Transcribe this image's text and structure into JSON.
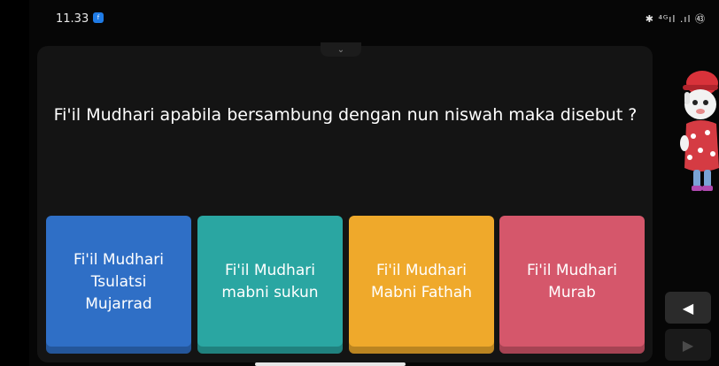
{
  "status_bar": {
    "time": "11.33",
    "app_badge": "f",
    "icons": "✱ ⁴ᴳıl .ıl ㊸"
  },
  "quiz": {
    "toggle_icon": "⌄",
    "question": "Fi'il Mudhari apabila bersambung dengan nun niswah maka disebut ?",
    "answers": [
      {
        "label": "Fi'il Mudhari Tsulatsi Mujarrad",
        "color": "#2f6fc6"
      },
      {
        "label": "Fi'il Mudhari mabni sukun",
        "color": "#2aa6a2"
      },
      {
        "label": "Fi'il Mudhari Mabni Fathah",
        "color": "#efa92b"
      },
      {
        "label": "Fi'il Mudhari Murab",
        "color": "#d5576b"
      }
    ]
  },
  "nav": {
    "prev_icon": "◀",
    "next_icon": "▶"
  }
}
